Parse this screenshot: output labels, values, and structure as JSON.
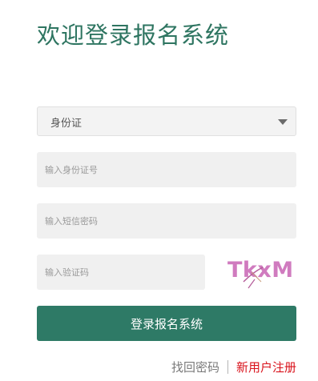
{
  "title": "欢迎登录报名系统",
  "form": {
    "id_type": {
      "selected": "身份证"
    },
    "id_number": {
      "placeholder": "输入身份证号",
      "value": ""
    },
    "sms_code": {
      "placeholder": "输入短信密码",
      "value": ""
    },
    "captcha": {
      "placeholder": "输入验证码",
      "value": "",
      "image_text": "TkxM"
    },
    "submit_label": "登录报名系统"
  },
  "links": {
    "forgot_password": "找回密码",
    "register": "新用户注册"
  },
  "colors": {
    "brand_green": "#2e7a66",
    "title_green": "#2e7561",
    "register_red": "#d9121b",
    "captcha_pink": "#d07bbf"
  }
}
